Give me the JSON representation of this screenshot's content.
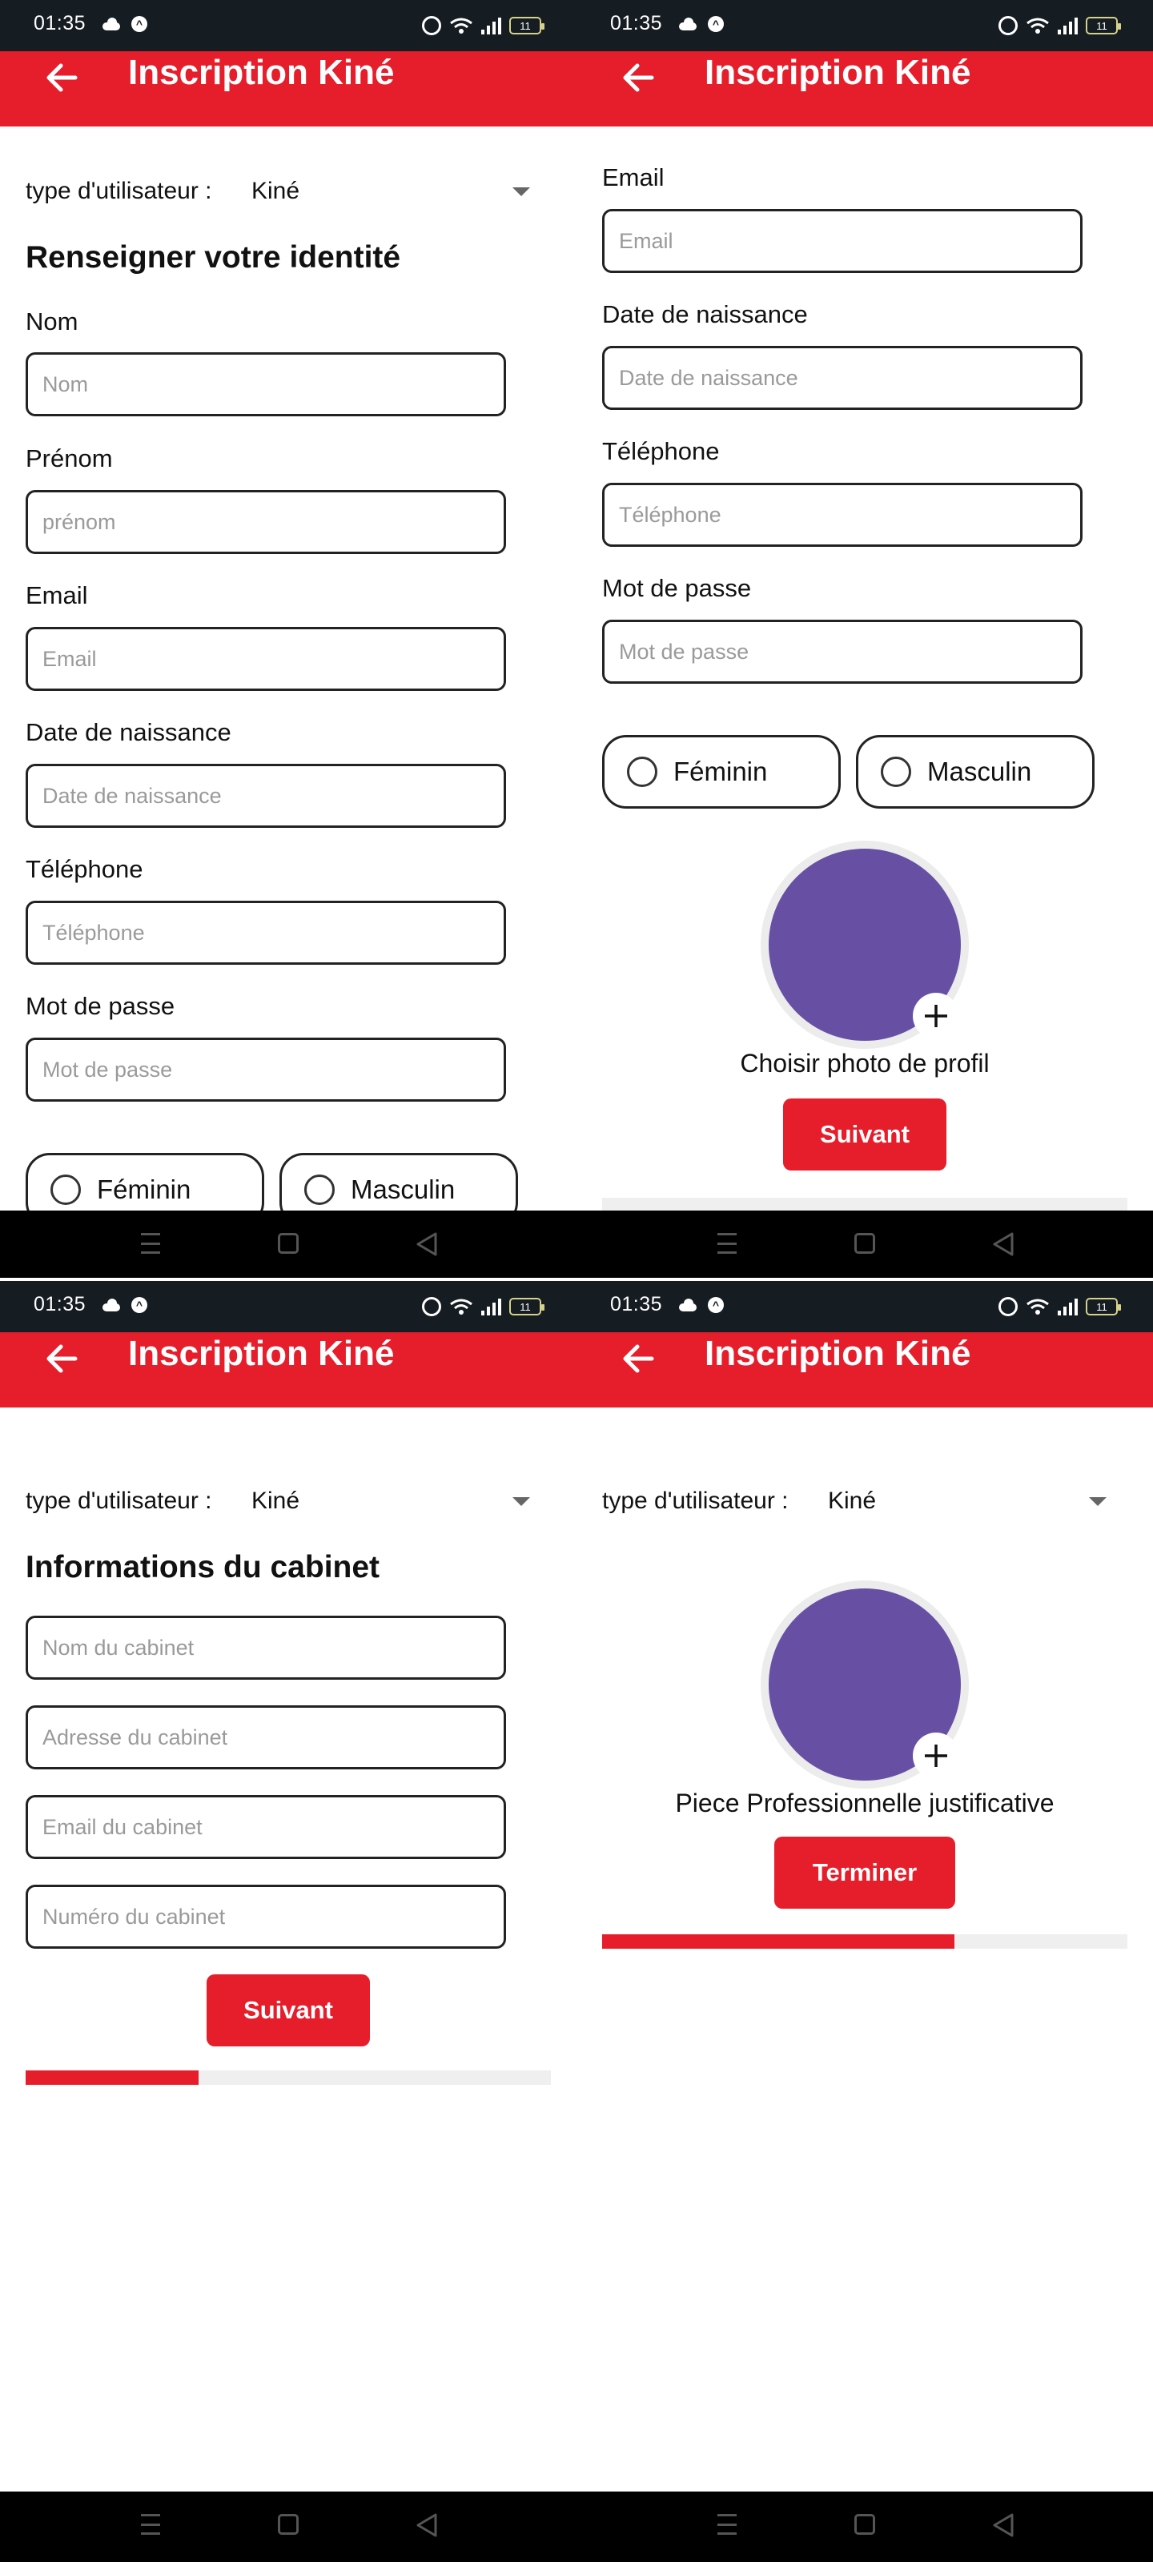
{
  "status": {
    "time": "01:35",
    "battery": "11"
  },
  "app": {
    "title": "Inscription Kiné"
  },
  "user_type": {
    "label": "type d'utilisateur :",
    "value": "Kiné"
  },
  "screen1": {
    "section_title": "Renseigner votre identité",
    "fields": [
      {
        "label": "Nom",
        "placeholder": "Nom"
      },
      {
        "label": "Prénom",
        "placeholder": "prénom"
      },
      {
        "label": "Email",
        "placeholder": "Email"
      },
      {
        "label": "Date de naissance",
        "placeholder": "Date de naissance"
      },
      {
        "label": "Téléphone",
        "placeholder": "Téléphone"
      },
      {
        "label": "Mot de passe",
        "placeholder": "Mot de passe"
      }
    ],
    "gender": {
      "female": "Féminin",
      "male": "Masculin"
    }
  },
  "screen2": {
    "fields": [
      {
        "label": "Email",
        "placeholder": "Email"
      },
      {
        "label": "Date de naissance",
        "placeholder": "Date de naissance"
      },
      {
        "label": "Téléphone",
        "placeholder": "Téléphone"
      },
      {
        "label": "Mot de passe",
        "placeholder": "Mot de passe"
      }
    ],
    "gender": {
      "female": "Féminin",
      "male": "Masculin"
    },
    "photo_caption": "Choisir photo de profil",
    "next_button": "Suivant"
  },
  "screen3": {
    "section_title": "Informations du cabinet",
    "fields": [
      {
        "placeholder": "Nom du cabinet"
      },
      {
        "placeholder": "Adresse du cabinet"
      },
      {
        "placeholder": "Email du cabinet"
      },
      {
        "placeholder": "Numéro du cabinet"
      }
    ],
    "next_button": "Suivant",
    "progress": 0.33
  },
  "screen4": {
    "photo_caption": "Piece Professionnelle justificative",
    "finish_button": "Terminer",
    "progress": 0.67
  },
  "colors": {
    "primary": "#e61e2b",
    "avatar": "#6750a4",
    "status_bar": "#151c22"
  },
  "icons": [
    "back-arrow-icon",
    "dropdown-arrow-icon",
    "plus-icon",
    "radio-circle-icon",
    "alarm-icon",
    "wifi-icon",
    "signal-icon",
    "battery-icon",
    "nav-menu-icon",
    "nav-home-icon",
    "nav-back-icon"
  ]
}
